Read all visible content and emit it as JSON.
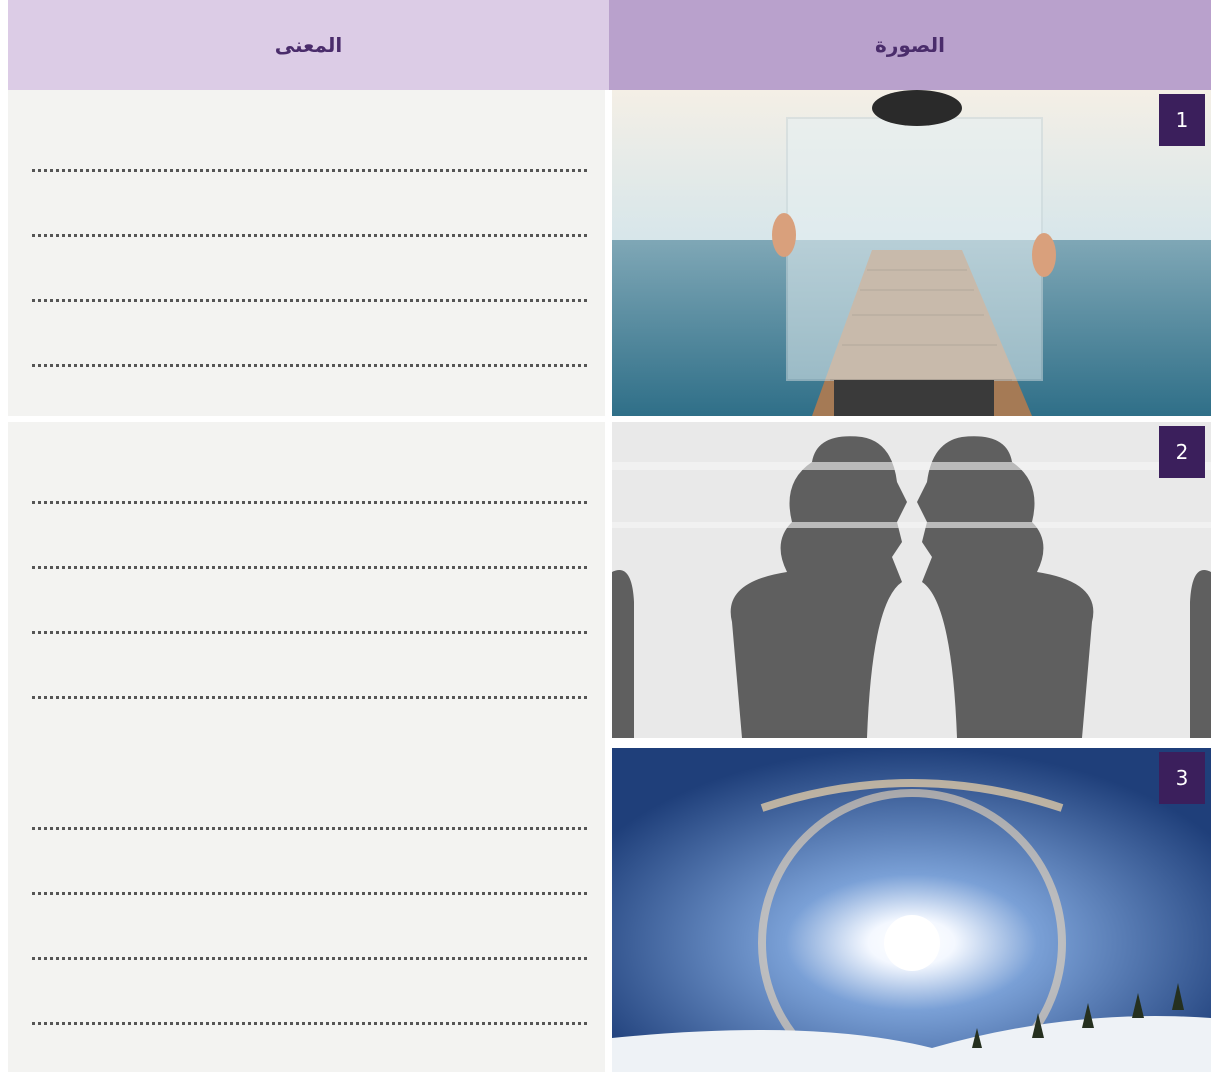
{
  "headers": {
    "meaning": "المعنى",
    "image": "الصورة"
  },
  "rows": [
    {
      "number": "1",
      "image_icon": "mirror-pier-photo-icon"
    },
    {
      "number": "2",
      "image_icon": "vase-faces-illusion-icon"
    },
    {
      "number": "3",
      "image_icon": "sun-halo-photo-icon"
    }
  ],
  "colors": {
    "header_meaning": "#dccce6",
    "header_image": "#b9a1cc",
    "badge": "#3b1f5c",
    "answer_bg": "#f3f3f1"
  }
}
